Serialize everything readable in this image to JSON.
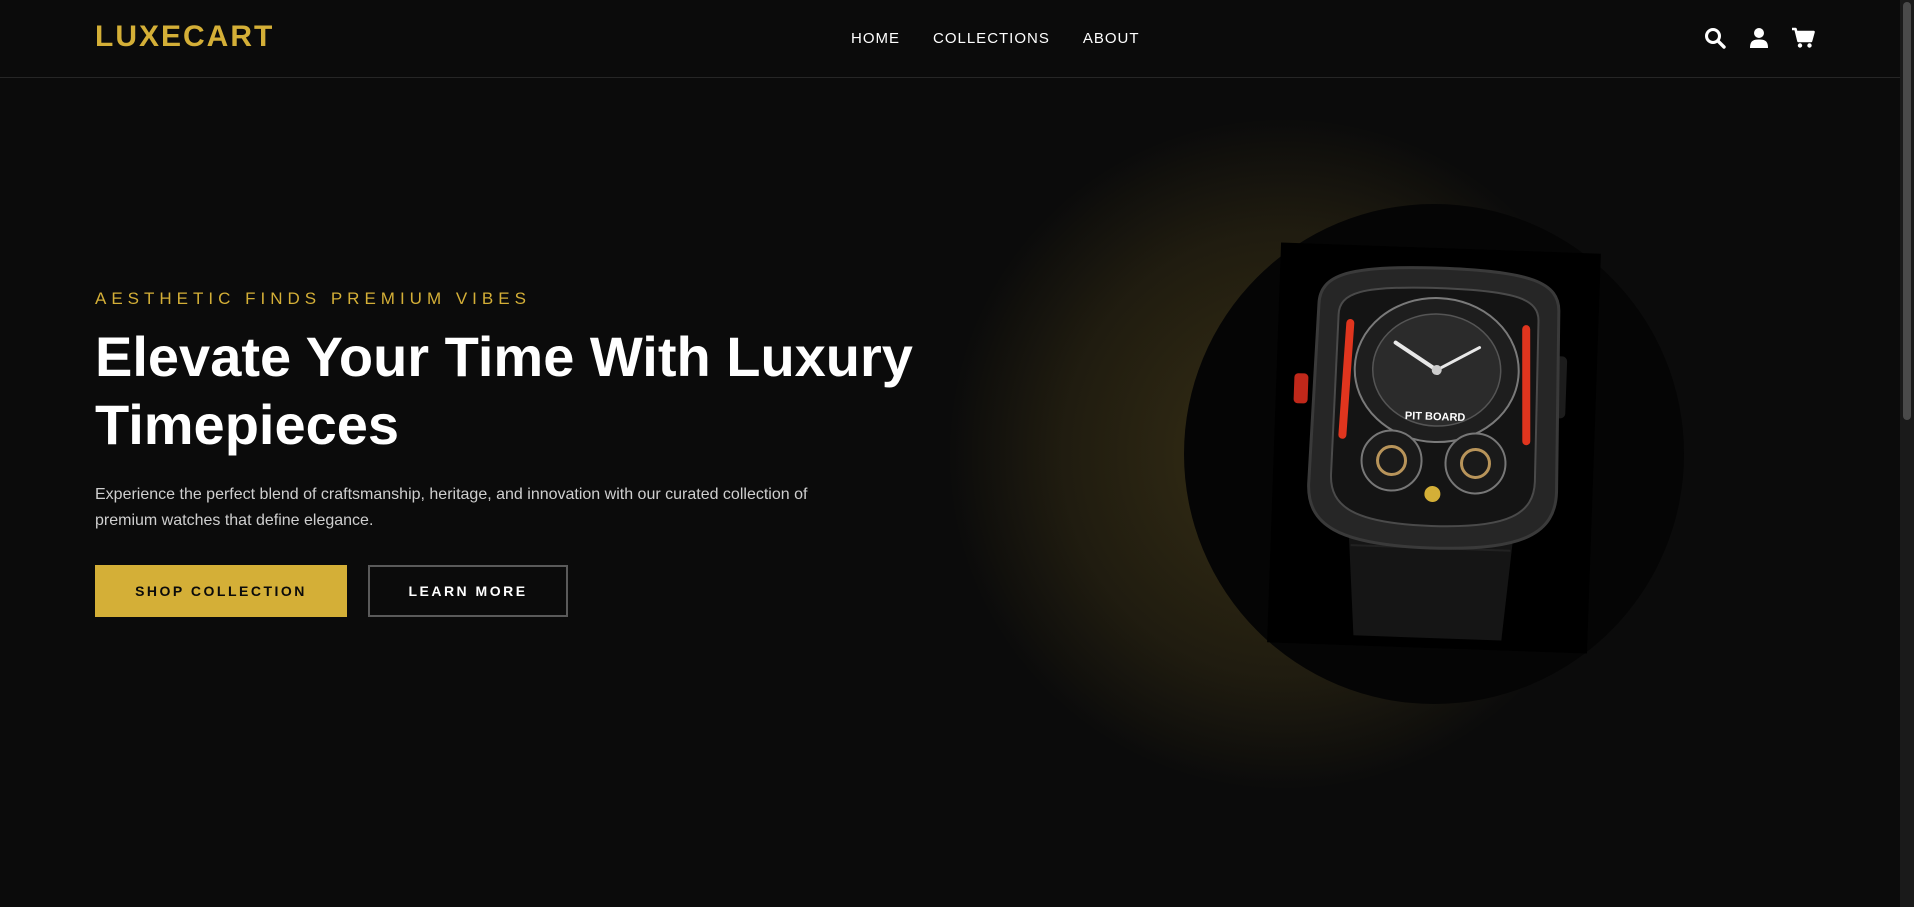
{
  "brand": {
    "logo": "LUXECART",
    "accent_color": "#d4af37"
  },
  "nav": {
    "items": [
      {
        "label": "HOME"
      },
      {
        "label": "COLLECTIONS"
      },
      {
        "label": "ABOUT"
      }
    ]
  },
  "header_icons": [
    {
      "name": "search-icon"
    },
    {
      "name": "user-icon"
    },
    {
      "name": "cart-icon"
    }
  ],
  "hero": {
    "eyebrow": "AESTHETIC FINDS PREMIUM VIBES",
    "headline": "Elevate Your Time With Luxury Timepieces",
    "description": "Experience the perfect blend of craftsmanship, heritage, and innovation with our curated collection of premium watches that define elegance.",
    "primary_button": "SHOP COLLECTION",
    "secondary_button": "LEARN MORE",
    "image": {
      "subject": "luxury-watch",
      "dial_text": "PIT BOARD"
    }
  }
}
